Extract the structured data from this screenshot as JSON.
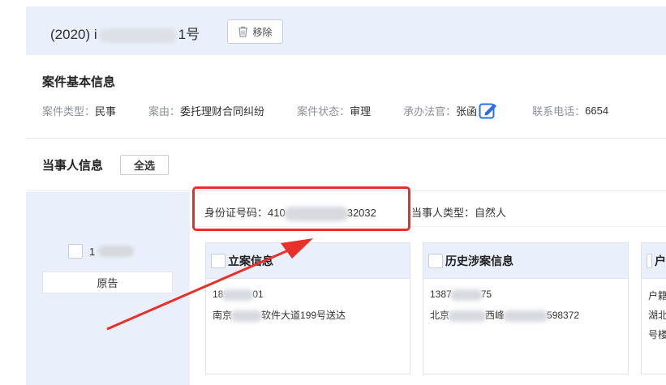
{
  "case": {
    "title_prefix": "(2020) ",
    "title_partial": "i",
    "title_suffix": "1号",
    "remove_label": "移除"
  },
  "basic": {
    "title": "案件基本信息",
    "case_type_label": "案件类型：",
    "case_type": "民事",
    "cause_label": "案由：",
    "cause": "委托理财合同纠纷",
    "status_label": "案件状态：",
    "status": "审理",
    "judge_label": "承办法官：",
    "judge": "张函",
    "phone_label": "联系电话：",
    "phone": "6654"
  },
  "party": {
    "title": "当事人信息",
    "select_all": "全选",
    "name_prefix": "1",
    "role": "原告",
    "id_label": "身份证号码：",
    "id_prefix": "410",
    "id_suffix": "32032",
    "type_label": "当事人类型：",
    "type": "自然人"
  },
  "cards": {
    "filing": {
      "title": "立案信息",
      "line1_a": "18",
      "line1_b": "01",
      "line2_a": "南京",
      "line2_b": "软件大道199号送达"
    },
    "history": {
      "title": "历史涉案信息",
      "line1_a": "1387",
      "line1_b": "75",
      "line2_a": "北京",
      "line2_b": "西峰",
      "line2_c": "598372"
    },
    "third": {
      "title": "户",
      "line1": "户籍",
      "line2": "湖北",
      "line3": "号楼"
    }
  },
  "colors": {
    "accent": "#2b6de5",
    "highlight": "#e8302a",
    "header_bg": "#e9f0fb"
  }
}
